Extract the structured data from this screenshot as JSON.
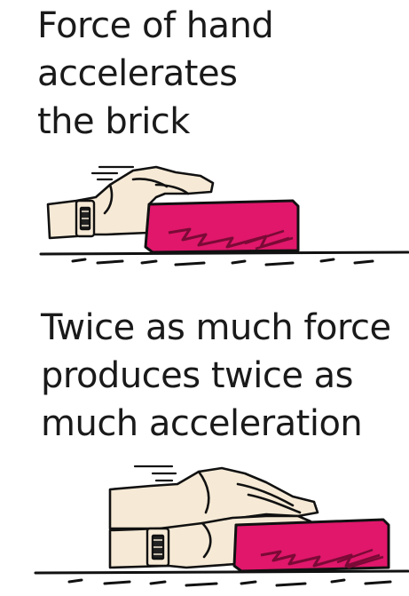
{
  "diagram": {
    "caption_top": [
      "Force of hand",
      "accelerates",
      "the brick"
    ],
    "caption_bottom": [
      "Twice as much force",
      "produces twice as",
      "much acceleration"
    ]
  },
  "colors": {
    "brick": "#e0176b",
    "brick_shadow": "#7a0a36",
    "skin": "#f6ead6",
    "ink": "#111111"
  }
}
